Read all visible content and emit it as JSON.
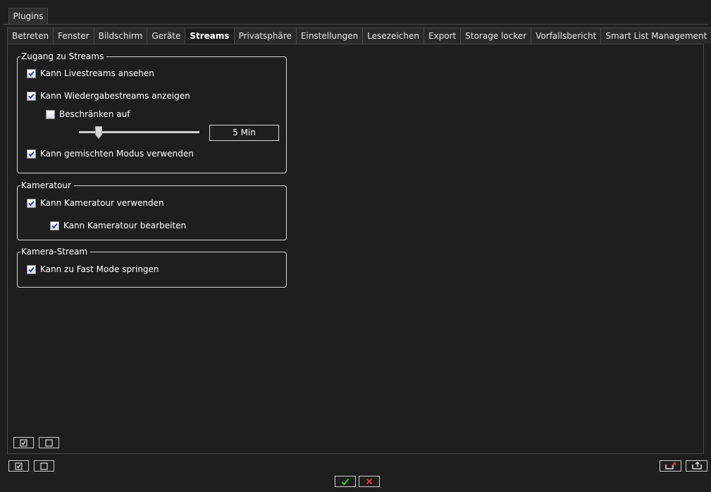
{
  "top_tabs": [
    {
      "label": "Plugins"
    }
  ],
  "tabs": [
    {
      "label": "Betreten"
    },
    {
      "label": "Fenster"
    },
    {
      "label": "Bildschirm"
    },
    {
      "label": "Geräte"
    },
    {
      "label": "Streams",
      "active": true
    },
    {
      "label": "Privatsphäre"
    },
    {
      "label": "Einstellungen"
    },
    {
      "label": "Lesezeichen"
    },
    {
      "label": "Export"
    },
    {
      "label": "Storage locker"
    },
    {
      "label": "Vorfallsbericht"
    },
    {
      "label": "Smart List Management"
    }
  ],
  "groups": {
    "streams_access": {
      "title": "Zugang zu Streams",
      "live": {
        "label": "Kann Livestreams ansehen",
        "checked": true
      },
      "playback": {
        "label": "Kann Wiedergabestreams anzeigen",
        "checked": true
      },
      "restrict": {
        "label": "Beschränken auf",
        "checked": false
      },
      "restrict_value": "5 Min",
      "mixed": {
        "label": "Kann gemischten Modus verwenden",
        "checked": true
      }
    },
    "camera_tour": {
      "title": "Kameratour",
      "use": {
        "label": "Kann Kameratour verwenden",
        "checked": true
      },
      "edit": {
        "label": "Kann Kameratour bearbeiten",
        "checked": true
      }
    },
    "camera_stream": {
      "title": "Kamera-Stream",
      "fast_mode": {
        "label": "Kann zu Fast Mode springen",
        "checked": true
      }
    }
  },
  "slider": {
    "value_fraction": 0.17
  },
  "icons": {
    "select_all": "check-all-icon",
    "deselect_all": "uncheck-all-icon",
    "export": "export-icon",
    "import": "import-icon",
    "ok": "checkmark-icon",
    "cancel": "cross-icon"
  },
  "colors": {
    "background": "#1e1e1e",
    "ok": "#3fbf2f",
    "cancel": "#e03030",
    "accent": "#e04040"
  }
}
